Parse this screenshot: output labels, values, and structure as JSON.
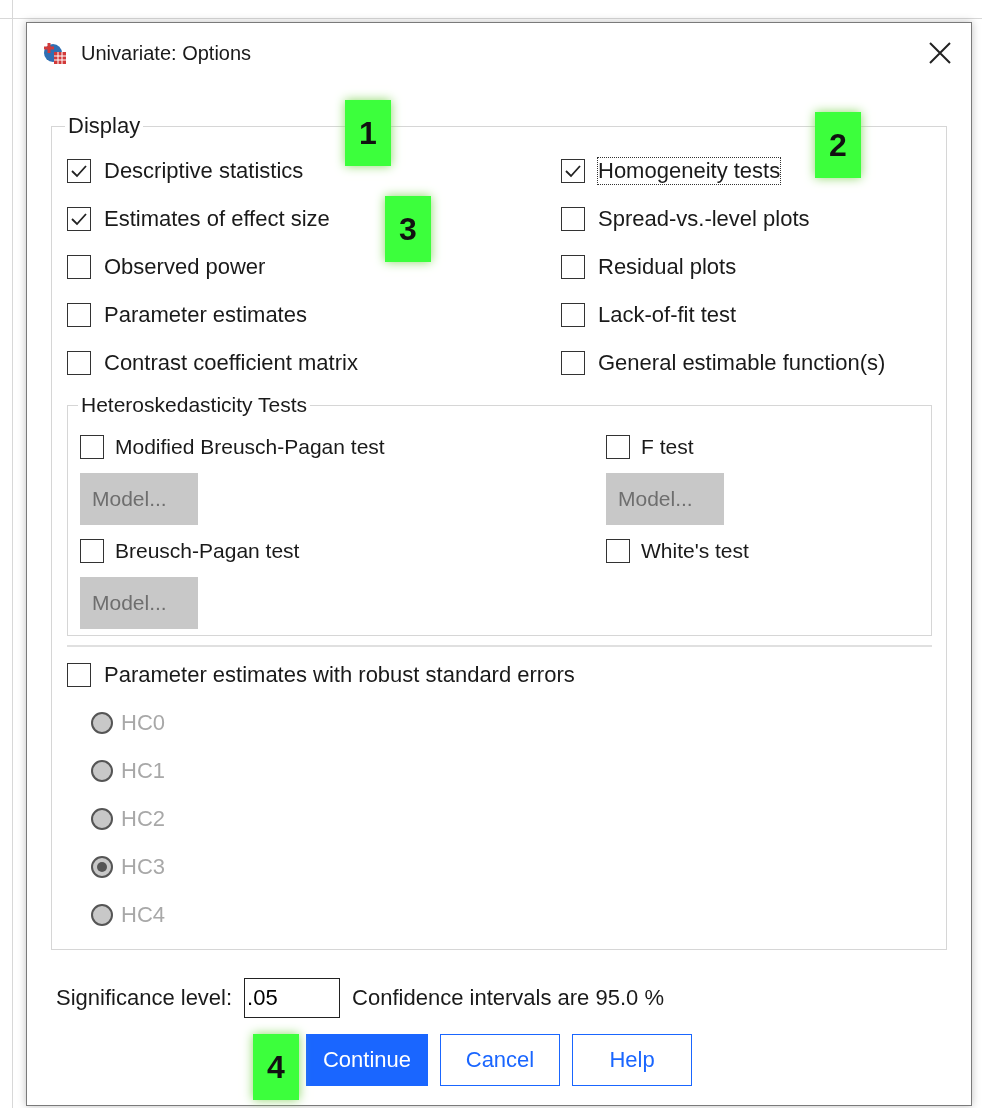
{
  "window": {
    "title": "Univariate: Options"
  },
  "display": {
    "title": "Display",
    "options": [
      {
        "label": "Descriptive statistics",
        "checked": true,
        "focused": false
      },
      {
        "label": "Homogeneity tests",
        "checked": true,
        "focused": true
      },
      {
        "label": "Estimates of effect size",
        "checked": true,
        "focused": false
      },
      {
        "label": "Spread-vs.-level plots",
        "checked": false,
        "focused": false
      },
      {
        "label": "Observed power",
        "checked": false,
        "focused": false
      },
      {
        "label": "Residual plots",
        "checked": false,
        "focused": false
      },
      {
        "label": "Parameter estimates",
        "checked": false,
        "focused": false
      },
      {
        "label": "Lack-of-fit test",
        "checked": false,
        "focused": false
      },
      {
        "label": "Contrast coefficient matrix",
        "checked": false,
        "focused": false
      },
      {
        "label": "General estimable function(s)",
        "checked": false,
        "focused": false
      }
    ]
  },
  "heteroskedasticity": {
    "title": "Heteroskedasticity Tests",
    "tests": [
      {
        "label": "Modified Breusch-Pagan test",
        "checked": false,
        "model_button": {
          "label": "Model...",
          "disabled": true
        }
      },
      {
        "label": "F test",
        "checked": false,
        "model_button": {
          "label": "Model...",
          "disabled": true
        }
      },
      {
        "label": "Breusch-Pagan test",
        "checked": false,
        "model_button": {
          "label": "Model...",
          "disabled": true
        }
      },
      {
        "label": "White's test",
        "checked": false
      }
    ]
  },
  "robust": {
    "label": "Parameter estimates with robust standard errors",
    "checked": false,
    "options": [
      {
        "label": "HC0",
        "selected": false,
        "disabled": true
      },
      {
        "label": "HC1",
        "selected": false,
        "disabled": true
      },
      {
        "label": "HC2",
        "selected": false,
        "disabled": true
      },
      {
        "label": "HC3",
        "selected": true,
        "disabled": true
      },
      {
        "label": "HC4",
        "selected": false,
        "disabled": true
      }
    ]
  },
  "significance": {
    "label": "Significance level:",
    "value": ".05"
  },
  "confidence_text": "Confidence intervals are 95.0 %",
  "buttons": [
    {
      "label": "Continue",
      "default": true
    },
    {
      "label": "Cancel",
      "default": false
    },
    {
      "label": "Help",
      "default": false
    }
  ],
  "annotations": [
    "1",
    "2",
    "3",
    "4"
  ]
}
